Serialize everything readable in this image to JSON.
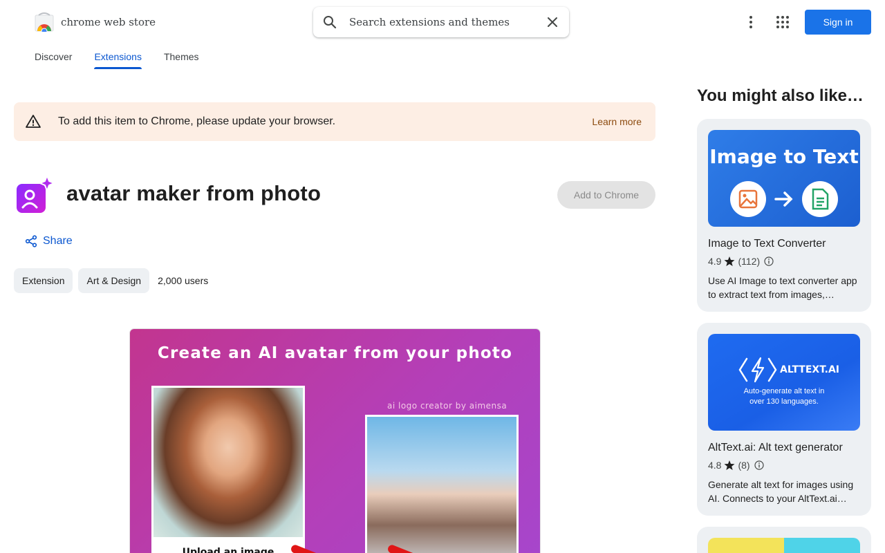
{
  "header": {
    "logo_text": "chrome web store",
    "search_placeholder": "Search extensions and themes",
    "sign_in_label": "Sign in"
  },
  "tabs": [
    {
      "label": "Discover",
      "active": false
    },
    {
      "label": "Extensions",
      "active": true
    },
    {
      "label": "Themes",
      "active": false
    }
  ],
  "banner": {
    "message": "To add this item to Chrome, please update your browser.",
    "link_label": "Learn more"
  },
  "extension": {
    "title": "avatar maker from photo",
    "add_button_label": "Add to Chrome",
    "share_label": "Share",
    "chips": [
      "Extension",
      "Art & Design"
    ],
    "users": "2,000 users"
  },
  "hero": {
    "title": "Create an AI avatar from your photo",
    "watermark": "ai logo creator by aimensa",
    "caption": "Upload an image"
  },
  "sidebar": {
    "heading": "You might also like…",
    "items": [
      {
        "name": "Image to Text Converter",
        "rating": "4.9",
        "reviews": "(112)",
        "description": "Use AI Image to text converter app to extract text from images,…",
        "thumb_title": "Image to Text"
      },
      {
        "name": "AltText.ai: Alt text generator",
        "rating": "4.8",
        "reviews": "(8)",
        "description": "Generate alt text for images using AI. Connects to your AltText.ai…",
        "thumb_brand": "ALTTEXT.AI",
        "thumb_sub": "Auto-generate alt text in over 130 languages."
      }
    ]
  },
  "colors": {
    "accent": "#0b57d0",
    "sign_in_bg": "#1a73e8",
    "banner_bg": "#fdeee4"
  }
}
